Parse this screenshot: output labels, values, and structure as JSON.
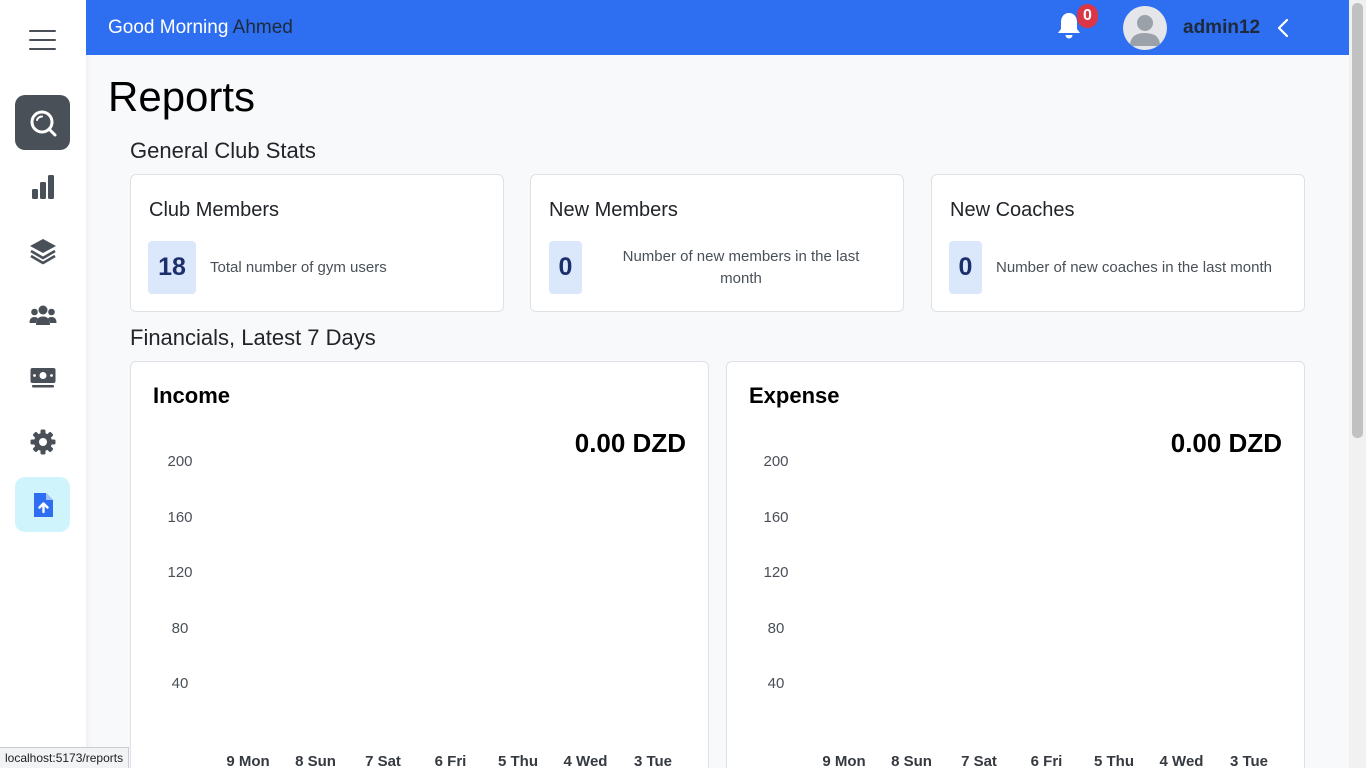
{
  "header": {
    "greeting": "Good Morning",
    "greeting_name": "Ahmed",
    "notification_count": "0",
    "username": "admin12"
  },
  "sidebar": {
    "items": [
      {
        "icon": "search-icon",
        "state": "highlighted"
      },
      {
        "icon": "bar-chart-icon"
      },
      {
        "icon": "layers-icon"
      },
      {
        "icon": "users-icon"
      },
      {
        "icon": "money-icon"
      },
      {
        "icon": "gear-icon"
      },
      {
        "icon": "file-upload-icon",
        "state": "active"
      }
    ]
  },
  "page": {
    "title": "Reports",
    "general_section_title": "General Club Stats",
    "financial_section_title": "Financials, Latest 7 Days"
  },
  "stats": [
    {
      "title": "Club Members",
      "value": "18",
      "description": "Total number of gym users"
    },
    {
      "title": "New Members",
      "value": "0",
      "description": "Number of new members in the last month"
    },
    {
      "title": "New Coaches",
      "value": "0",
      "description": "Number of new coaches in the last month"
    }
  ],
  "financials": {
    "income": {
      "title": "Income",
      "total": "0.00 DZD"
    },
    "expense": {
      "title": "Expense",
      "total": "0.00 DZD"
    }
  },
  "chart_data": [
    {
      "type": "bar",
      "title": "Income",
      "categories": [
        "9 Mon",
        "8 Sun",
        "7 Sat",
        "6 Fri",
        "5 Thu",
        "4 Wed",
        "3 Tue"
      ],
      "values": [
        0,
        0,
        0,
        0,
        0,
        0,
        0
      ],
      "y_ticks": [
        "200",
        "160",
        "120",
        "80",
        "40"
      ],
      "ylim": [
        0,
        200
      ],
      "grid": false
    },
    {
      "type": "bar",
      "title": "Expense",
      "categories": [
        "9 Mon",
        "8 Sun",
        "7 Sat",
        "6 Fri",
        "5 Thu",
        "4 Wed",
        "3 Tue"
      ],
      "values": [
        0,
        0,
        0,
        0,
        0,
        0,
        0
      ],
      "y_ticks": [
        "200",
        "160",
        "120",
        "80",
        "40"
      ],
      "ylim": [
        0,
        200
      ],
      "grid": false
    }
  ],
  "statusbar": {
    "url": "localhost:5173/reports"
  },
  "colors": {
    "topbar": "#2d6ff0",
    "sidebar_active_bg": "#cff4fc",
    "sidebar_active_icon": "#2d6ff0",
    "badge": "#dc3545",
    "stat_num_bg": "#dbe7fb"
  }
}
